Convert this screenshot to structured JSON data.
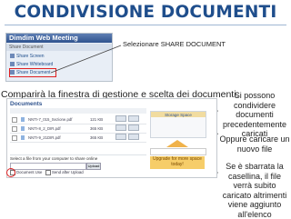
{
  "title": "CONDIVISIONE DOCUMENTI",
  "menu": {
    "header": "Dimdim Web Meeting",
    "subtitle": "Share Document",
    "items": [
      "Share Screen",
      "Share Whiteboard",
      "Share Document"
    ]
  },
  "callout_share": "Selezionare SHARE DOCUMENT",
  "heading": "Comparirà la finestra di gestione e scelta dei documenti:",
  "panel": {
    "title": "Documents",
    "rows": [
      {
        "name": "NNTI-7_015_Sezione.pdf",
        "size": "121 KB"
      },
      {
        "name": "NNTI-8_2_DIR.pdf",
        "size": "365 KB"
      },
      {
        "name": "NNTI-9_21DIR.pdf",
        "size": "365 KB"
      }
    ],
    "side_title": "Storage Space",
    "upgrade_text": "Upgrade for more space today!",
    "upload_label": "Select a file from your computer to share online",
    "upload_button": "Upload",
    "checkbox1": "Document Use",
    "checkbox2": "Send after Upload"
  },
  "notes": {
    "n1": "Si possono condividere documenti precedentemente caricati",
    "n2": "Oppure caricare un nuovo file",
    "n3": "Se è sbarrata la casellina, il file verrà subito caricato altrimenti viene aggiunto all'elenco"
  }
}
